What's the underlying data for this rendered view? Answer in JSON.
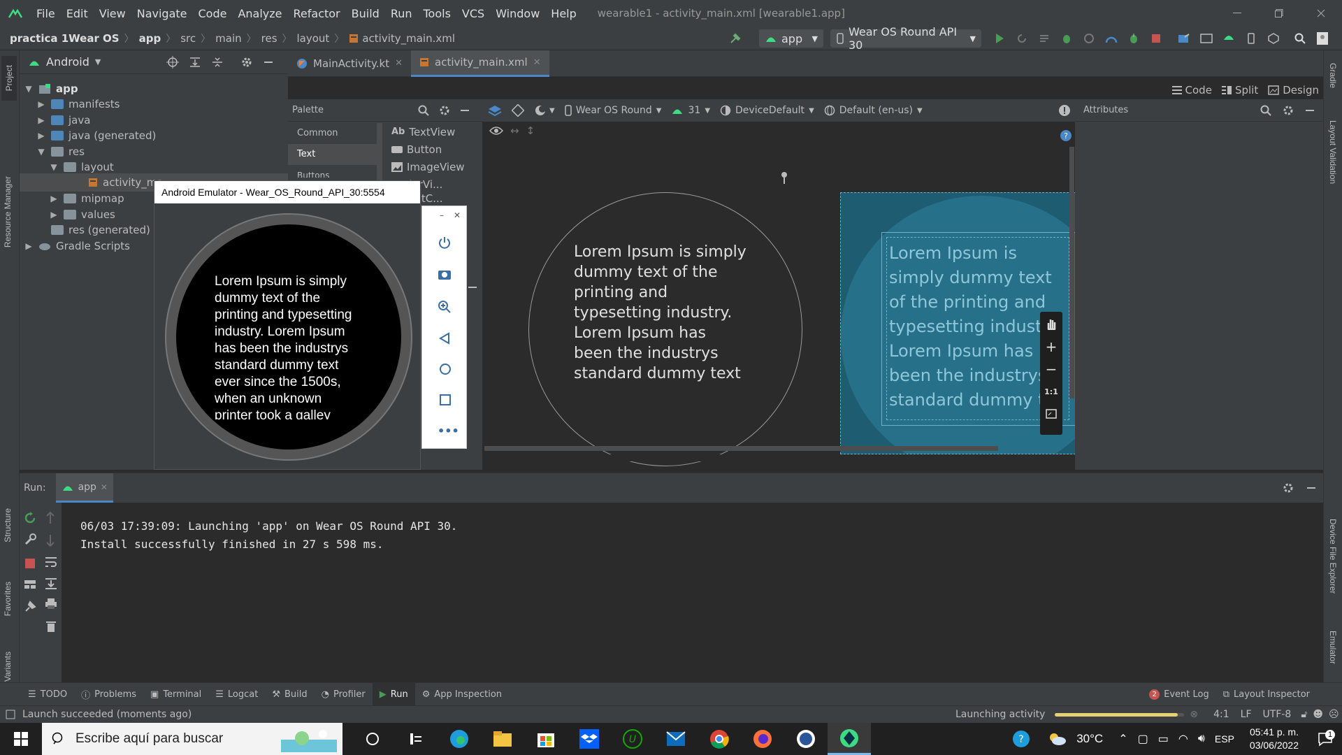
{
  "window": {
    "title": "wearable1 - activity_main.xml [wearable1.app]"
  },
  "menu": [
    "File",
    "Edit",
    "View",
    "Navigate",
    "Code",
    "Analyze",
    "Refactor",
    "Build",
    "Run",
    "Tools",
    "VCS",
    "Window",
    "Help"
  ],
  "breadcrumb": [
    "practica 1Wear OS",
    "app",
    "src",
    "main",
    "res",
    "layout",
    "activity_main.xml"
  ],
  "toolbar": {
    "module": "app",
    "device": "Wear OS Round API 30"
  },
  "project": {
    "view": "Android",
    "side_label": "Project",
    "tree": [
      {
        "label": "app",
        "level": 0,
        "icon": "android-module-icon"
      },
      {
        "label": "manifests",
        "level": 1,
        "icon": "folder-icon"
      },
      {
        "label": "java",
        "level": 1,
        "icon": "folder-icon"
      },
      {
        "label": "java (generated)",
        "level": 1,
        "icon": "folder-icon"
      },
      {
        "label": "res",
        "level": 1,
        "icon": "folder-icon"
      },
      {
        "label": "layout",
        "level": 2,
        "icon": "folder-icon"
      },
      {
        "label": "activity_ma",
        "level": 3,
        "icon": "layout-file-icon"
      },
      {
        "label": "mipmap",
        "level": 2,
        "icon": "folder-icon"
      },
      {
        "label": "values",
        "level": 2,
        "icon": "folder-icon"
      },
      {
        "label": "res (generated)",
        "level": 1,
        "icon": "folder-icon"
      },
      {
        "label": "Gradle Scripts",
        "level": 0,
        "icon": "gradle-icon"
      }
    ]
  },
  "tabs": [
    {
      "label": "MainActivity.kt"
    },
    {
      "label": "activity_main.xml"
    }
  ],
  "view_modes": [
    "Code",
    "Split",
    "Design"
  ],
  "palette": {
    "title": "Palette",
    "categories": [
      "Common",
      "Text",
      "Buttons"
    ],
    "items": [
      "TextView",
      "Button",
      "ImageView",
      "cyclerVi...",
      "gmentC..."
    ]
  },
  "design_toolbar": {
    "device": "Wear OS Round",
    "api": "31",
    "theme": "DeviceDefault",
    "locale": "Default (en-us)"
  },
  "attributes": {
    "title": "Attributes"
  },
  "preview": {
    "design_text": "Lorem Ipsum is simply dummy text of the printing and typesetting industry. Lorem Ipsum has been the industrys standard dummy text ever since the 1500s, when an unknown",
    "blueprint_text": "Lorem Ipsum is simply dummy text of the printing and typesetting industry. Lorem Ipsum has been the industrys standard dummy te",
    "zoom_fit": "1:1"
  },
  "emulator": {
    "title": "Android Emulator - Wear_OS_Round_API_30:5554",
    "screen_text": "Lorem Ipsum is simply dummy text of the printing and typesetting industry. Lorem Ipsum has been the industrys standard dummy text ever since the 1500s, when an unknown printer took a galley"
  },
  "run": {
    "label": "Run:",
    "config": "app",
    "lines": [
      "06/03 17:39:09: Launching 'app' on Wear OS Round API 30.",
      "Install successfully finished in 27 s 598 ms."
    ]
  },
  "bottom_tools": [
    "TODO",
    "Problems",
    "Terminal",
    "Logcat",
    "Build",
    "Profiler",
    "Run",
    "App Inspection"
  ],
  "event_log": {
    "count": "2",
    "label": "Event Log"
  },
  "layout_inspector": "Layout Inspector",
  "left_side_labels": [
    "Resource Manager",
    "Structure",
    "Favorites",
    "Build Variants"
  ],
  "right_side_labels": [
    "Gradle",
    "Layout Validation",
    "Device File Explorer",
    "Emulator"
  ],
  "status": {
    "message": "Launch succeeded (moments ago)",
    "progress_label": "Launching activity",
    "progress": 0.95,
    "position": "4:1",
    "line_sep": "LF",
    "encoding": "UTF-8"
  },
  "taskbar": {
    "search_placeholder": "Escribe aquí para buscar",
    "temperature": "30°C",
    "language": "ESP",
    "time": "05:41 p. m.",
    "date": "03/06/2022",
    "notif_count": "1"
  },
  "colors": {
    "accent": "#4a88c7",
    "android_green": "#3ddc84",
    "blueprint": "#1e5c72"
  }
}
